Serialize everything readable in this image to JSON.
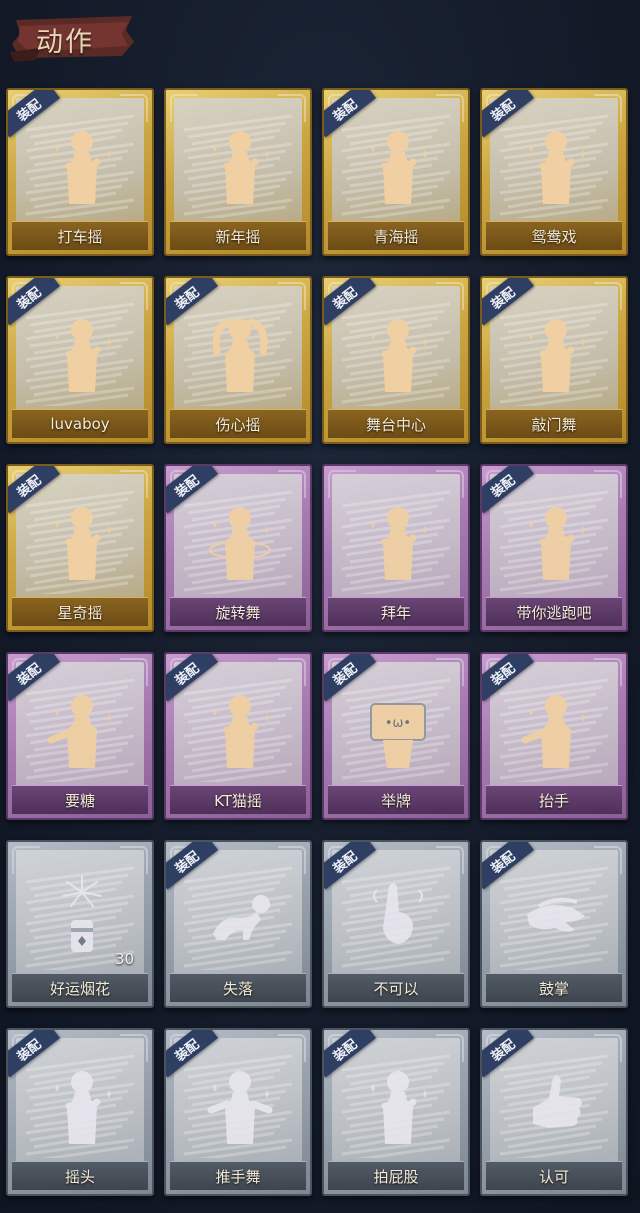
{
  "header": {
    "title": "动作"
  },
  "equip_label": "装配",
  "cards": [
    {
      "label": "打车摇",
      "tier": "gold",
      "equipped": true,
      "icon": "dance-figure-icon"
    },
    {
      "label": "新年摇",
      "tier": "gold",
      "equipped": false,
      "icon": "dance-figure-icon"
    },
    {
      "label": "青海摇",
      "tier": "gold",
      "equipped": true,
      "icon": "dance-figure-icon"
    },
    {
      "label": "鸳鸯戏",
      "tier": "gold",
      "equipped": true,
      "icon": "dance-figure-icon"
    },
    {
      "label": "luvaboy",
      "tier": "gold",
      "equipped": true,
      "icon": "dance-figure-icon"
    },
    {
      "label": "伤心摇",
      "tier": "gold",
      "equipped": true,
      "icon": "heart-hands-figure-icon"
    },
    {
      "label": "舞台中心",
      "tier": "gold",
      "equipped": true,
      "icon": "dance-figure-icon"
    },
    {
      "label": "敲门舞",
      "tier": "gold",
      "equipped": true,
      "icon": "dance-figure-icon"
    },
    {
      "label": "星奇摇",
      "tier": "gold",
      "equipped": true,
      "icon": "dance-figure-icon"
    },
    {
      "label": "旋转舞",
      "tier": "purple",
      "equipped": true,
      "icon": "spin-figure-icon"
    },
    {
      "label": "拜年",
      "tier": "purple",
      "equipped": false,
      "icon": "bow-figure-icon"
    },
    {
      "label": "带你逃跑吧",
      "tier": "purple",
      "equipped": true,
      "icon": "dance-figure-icon"
    },
    {
      "label": "要糖",
      "tier": "purple",
      "equipped": true,
      "icon": "reach-figure-icon"
    },
    {
      "label": "KT猫摇",
      "tier": "purple",
      "equipped": true,
      "icon": "dance-figure-icon"
    },
    {
      "label": "举牌",
      "tier": "purple",
      "equipped": true,
      "icon": "sign-figure-icon"
    },
    {
      "label": "抬手",
      "tier": "purple",
      "equipped": true,
      "icon": "raise-hand-figure-icon"
    },
    {
      "label": "好运烟花",
      "tier": "grey",
      "equipped": false,
      "icon": "firework-icon",
      "count": "30"
    },
    {
      "label": "失落",
      "tier": "grey",
      "equipped": true,
      "icon": "crawl-figure-icon"
    },
    {
      "label": "不可以",
      "tier": "grey",
      "equipped": true,
      "icon": "finger-wag-icon"
    },
    {
      "label": "鼓掌",
      "tier": "grey",
      "equipped": true,
      "icon": "clap-hands-icon"
    },
    {
      "label": "摇头",
      "tier": "grey",
      "equipped": true,
      "icon": "shake-head-figure-icon"
    },
    {
      "label": "推手舞",
      "tier": "grey",
      "equipped": true,
      "icon": "push-hands-figure-icon"
    },
    {
      "label": "拍屁股",
      "tier": "grey",
      "equipped": true,
      "icon": "dance-figure-icon"
    },
    {
      "label": "认可",
      "tier": "grey",
      "equipped": true,
      "icon": "thumbs-up-icon"
    }
  ]
}
